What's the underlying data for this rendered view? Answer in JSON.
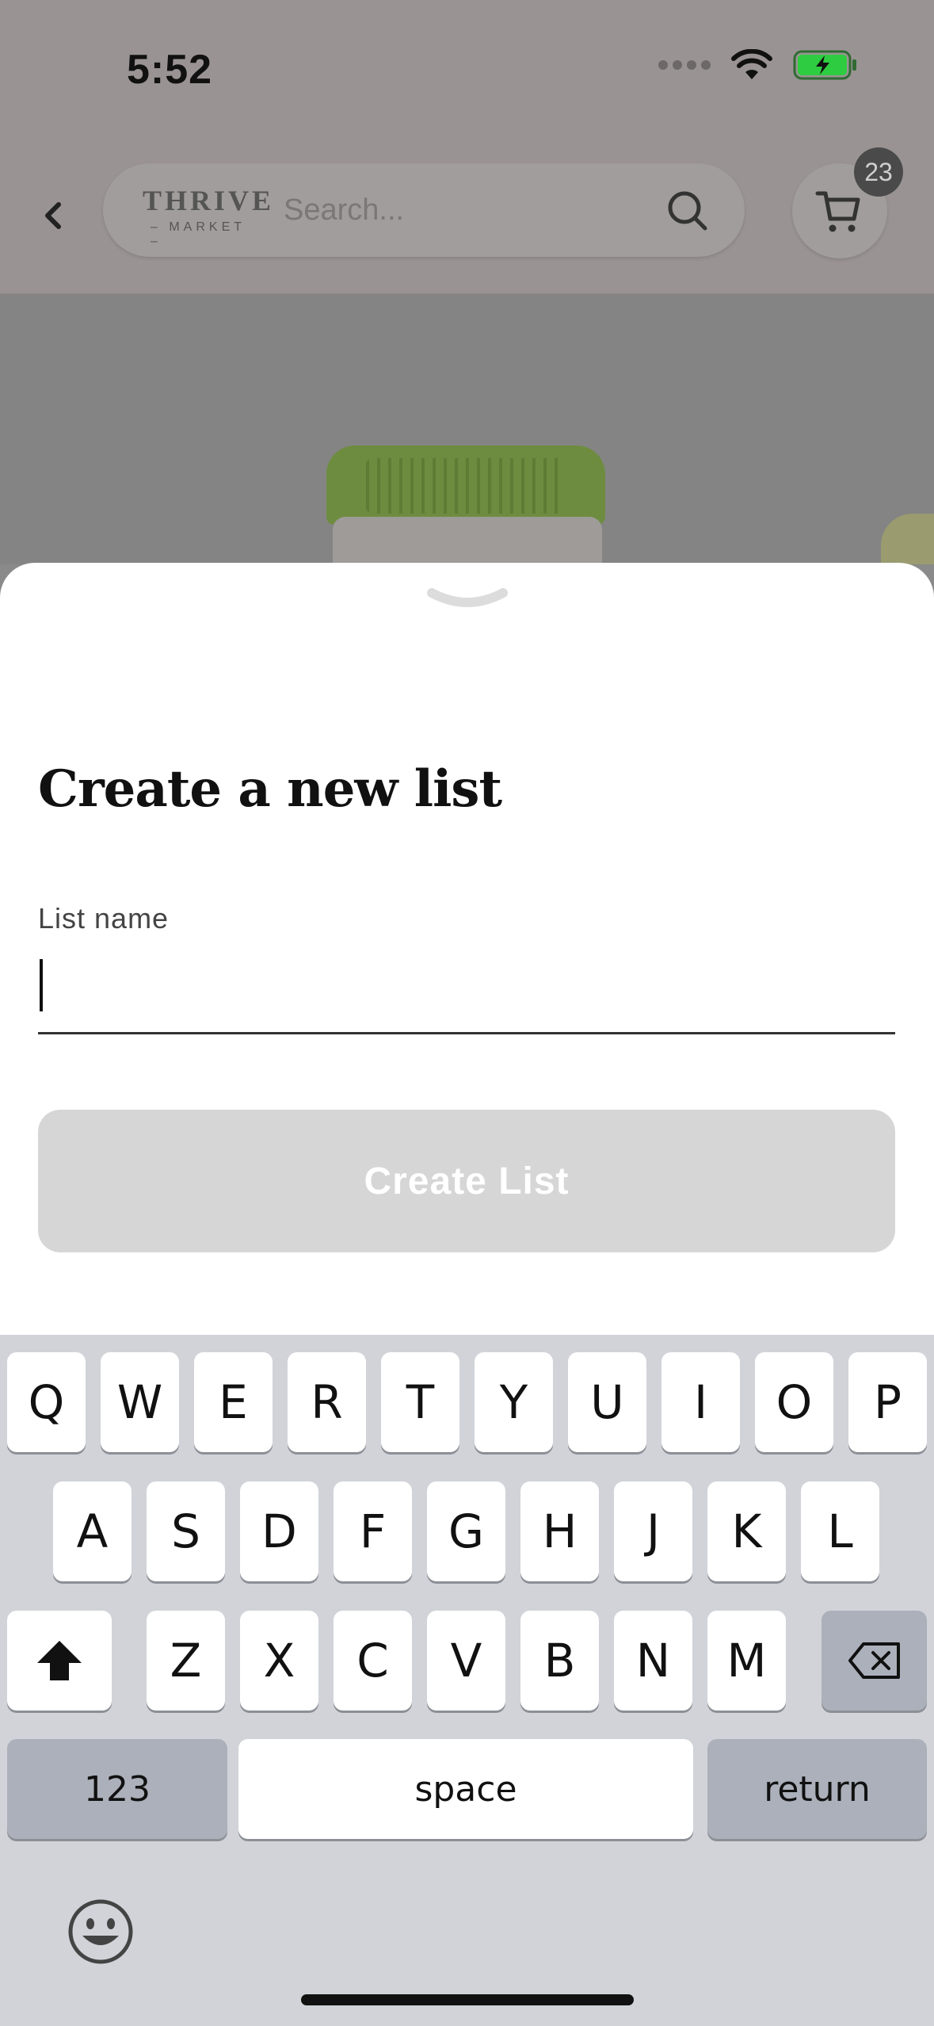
{
  "status_bar": {
    "time": "5:52"
  },
  "nav": {
    "back_icon": "chevron-left-icon",
    "logo_top": "THRIVE",
    "logo_bottom": "– MARKET –",
    "search_placeholder": "Search...",
    "search_icon": "search-icon",
    "cart_icon": "cart-icon",
    "cart_count": "23"
  },
  "sheet": {
    "title": "Create a new list",
    "field_label": "List name",
    "field_value": "",
    "button_label": "Create List",
    "button_enabled": false
  },
  "keyboard": {
    "row1": [
      "Q",
      "W",
      "E",
      "R",
      "T",
      "Y",
      "U",
      "I",
      "O",
      "P"
    ],
    "row2": [
      "A",
      "S",
      "D",
      "F",
      "G",
      "H",
      "J",
      "K",
      "L"
    ],
    "row3": [
      "Z",
      "X",
      "C",
      "V",
      "B",
      "N",
      "M"
    ],
    "numbers_label": "123",
    "space_label": "space",
    "return_label": "return"
  },
  "colors": {
    "sheet_bg": "#ffffff",
    "disabled_button": "#d6d6d6",
    "keyboard_bg": "#d1d3d9",
    "battery_green": "#2ecc40"
  }
}
